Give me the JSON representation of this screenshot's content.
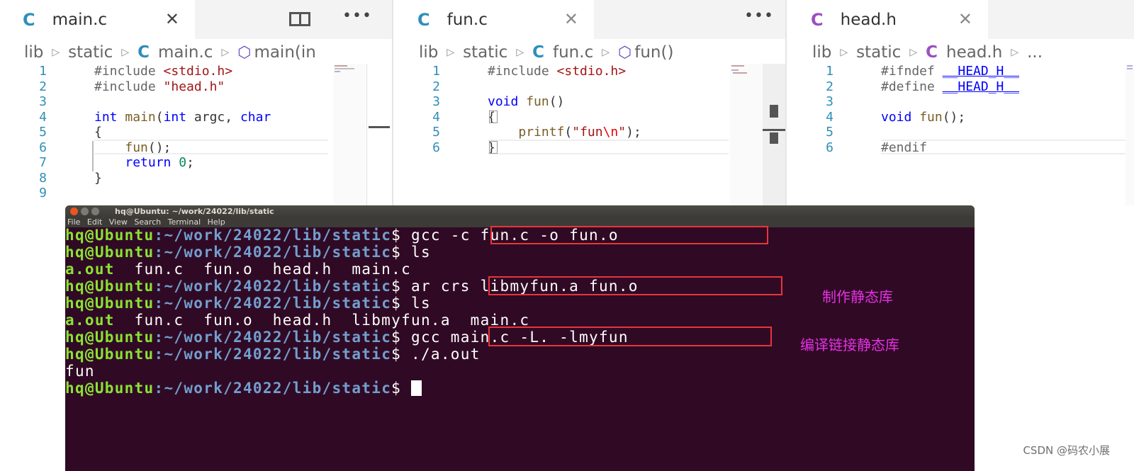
{
  "editors": [
    {
      "tab": {
        "lang": "C",
        "name": "main.c"
      },
      "crumbs": [
        "lib",
        "static",
        "main.c",
        "main(in"
      ],
      "lines": [
        {
          "n": "1",
          "tokens": [
            [
              "pre",
              "#include "
            ],
            [
              "str",
              "<stdio.h>"
            ]
          ]
        },
        {
          "n": "2",
          "tokens": [
            [
              "pre",
              "#include "
            ],
            [
              "str",
              "\"head.h\""
            ]
          ]
        },
        {
          "n": "3",
          "tokens": []
        },
        {
          "n": "4",
          "tokens": [
            [
              "kw",
              "int"
            ],
            [
              "",
              " "
            ],
            [
              "fn",
              "main"
            ],
            [
              "",
              "("
            ],
            [
              "kw",
              "int"
            ],
            [
              "",
              " argc, "
            ],
            [
              "kw",
              "char"
            ]
          ]
        },
        {
          "n": "5",
          "tokens": [
            [
              "",
              "{"
            ]
          ]
        },
        {
          "n": "6",
          "tokens": [
            [
              "",
              "    "
            ],
            [
              "fn",
              "fun"
            ],
            [
              "",
              "();"
            ]
          ]
        },
        {
          "n": "7",
          "tokens": [
            [
              "",
              "    "
            ],
            [
              "kw",
              "return"
            ],
            [
              "",
              " "
            ],
            [
              "num",
              "0"
            ],
            [
              "",
              ";"
            ]
          ]
        },
        {
          "n": "8",
          "tokens": [
            [
              "",
              "}"
            ]
          ]
        },
        {
          "n": "9",
          "tokens": []
        }
      ]
    },
    {
      "tab": {
        "lang": "C",
        "name": "fun.c"
      },
      "crumbs": [
        "lib",
        "static",
        "fun.c",
        "fun()"
      ],
      "lines": [
        {
          "n": "1",
          "tokens": [
            [
              "pre",
              "#include "
            ],
            [
              "str",
              "<stdio.h>"
            ]
          ]
        },
        {
          "n": "2",
          "tokens": []
        },
        {
          "n": "3",
          "tokens": [
            [
              "kw",
              "void"
            ],
            [
              "",
              " "
            ],
            [
              "fn",
              "fun"
            ],
            [
              "",
              "()"
            ]
          ]
        },
        {
          "n": "4",
          "tokens": [
            [
              "",
              "{"
            ]
          ]
        },
        {
          "n": "5",
          "tokens": [
            [
              "",
              "    "
            ],
            [
              "fn",
              "printf"
            ],
            [
              "",
              "("
            ],
            [
              "str",
              "\"fun"
            ],
            [
              "esc",
              "\\n"
            ],
            [
              "str",
              "\""
            ],
            [
              "",
              ");"
            ]
          ]
        },
        {
          "n": "6",
          "tokens": [
            [
              "",
              "}"
            ]
          ]
        }
      ]
    },
    {
      "tab": {
        "lang": "C",
        "name": "head.h"
      },
      "crumbs": [
        "lib",
        "static",
        "head.h",
        "..."
      ],
      "lines": [
        {
          "n": "1",
          "tokens": [
            [
              "pre",
              "#ifndef "
            ],
            [
              "mac",
              "__HEAD_H__"
            ]
          ]
        },
        {
          "n": "2",
          "tokens": [
            [
              "pre",
              "#define "
            ],
            [
              "mac",
              "__HEAD_H__"
            ]
          ]
        },
        {
          "n": "3",
          "tokens": []
        },
        {
          "n": "4",
          "tokens": [
            [
              "kw",
              "void"
            ],
            [
              "",
              " "
            ],
            [
              "fn",
              "fun"
            ],
            [
              "",
              "();"
            ]
          ]
        },
        {
          "n": "5",
          "tokens": []
        },
        {
          "n": "6",
          "tokens": [
            [
              "pre",
              "#endif"
            ]
          ]
        }
      ]
    }
  ],
  "terminal": {
    "title": "hq@Ubuntu: ~/work/24022/lib/static",
    "menu": [
      "File",
      "Edit",
      "View",
      "Search",
      "Terminal",
      "Help"
    ],
    "prompt_user": "hq@Ubuntu",
    "prompt_path": ":~/work/24022/lib/static",
    "lines": [
      {
        "type": "cmd",
        "text": "gcc -c fun.c -o fun.o"
      },
      {
        "type": "cmd",
        "text": "ls"
      },
      {
        "type": "out",
        "parts": [
          [
            "fg",
            "a.out"
          ],
          [
            "",
            "  fun.c  fun.o  head.h  main.c"
          ]
        ]
      },
      {
        "type": "cmd",
        "text": "ar crs libmyfun.a fun.o"
      },
      {
        "type": "cmd",
        "text": "ls"
      },
      {
        "type": "out",
        "parts": [
          [
            "fg",
            "a.out"
          ],
          [
            "",
            "  fun.c  fun.o  head.h  libmyfun.a  main.c"
          ]
        ]
      },
      {
        "type": "cmd",
        "text": "gcc main.c -L. -lmyfun"
      },
      {
        "type": "cmd",
        "text": "./a.out"
      },
      {
        "type": "out",
        "parts": [
          [
            "",
            "fun"
          ]
        ]
      },
      {
        "type": "cmd",
        "text": "",
        "cursor": true
      }
    ]
  },
  "annotations": {
    "make_static_lib": "制作静态库",
    "link_static_lib": "编译链接静态库"
  },
  "watermark": "CSDN @码农小展",
  "colors": {
    "terminal_bg": "#300a24",
    "prompt_user": "#8ae234",
    "prompt_path": "#729fcf",
    "highlight_box": "#e8353b",
    "annotation": "#e531e5",
    "c_icon": "#2f8fb8",
    "h_icon": "#9c4fc1"
  }
}
